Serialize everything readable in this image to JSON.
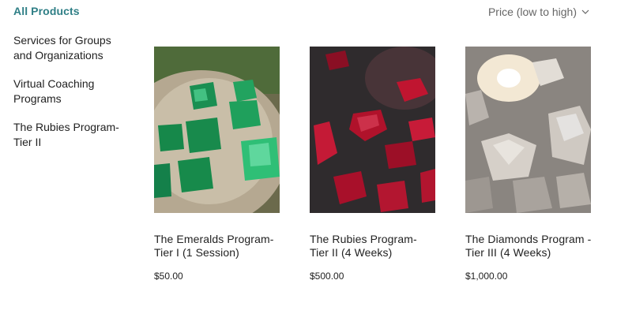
{
  "sidebar": {
    "all_label": "All Products",
    "items": [
      {
        "label": "Services for Groups and Organizations"
      },
      {
        "label": "Virtual Coaching Programs"
      },
      {
        "label": "The Rubies Program- Tier II"
      }
    ]
  },
  "sort": {
    "label": "Price (low to high)",
    "icon": "chevron-down-icon"
  },
  "products": [
    {
      "name": "The Emeralds Program- Tier I (1 Session)",
      "price": "$50.00",
      "color": "#1f9d5a"
    },
    {
      "name": "The Rubies Program- Tier II (4 Weeks)",
      "price": "$500.00",
      "color": "#b0122b"
    },
    {
      "name": "The Diamonds Program - Tier III (4 Weeks)",
      "price": "$1,000.00",
      "color": "#c9c3bd"
    }
  ]
}
